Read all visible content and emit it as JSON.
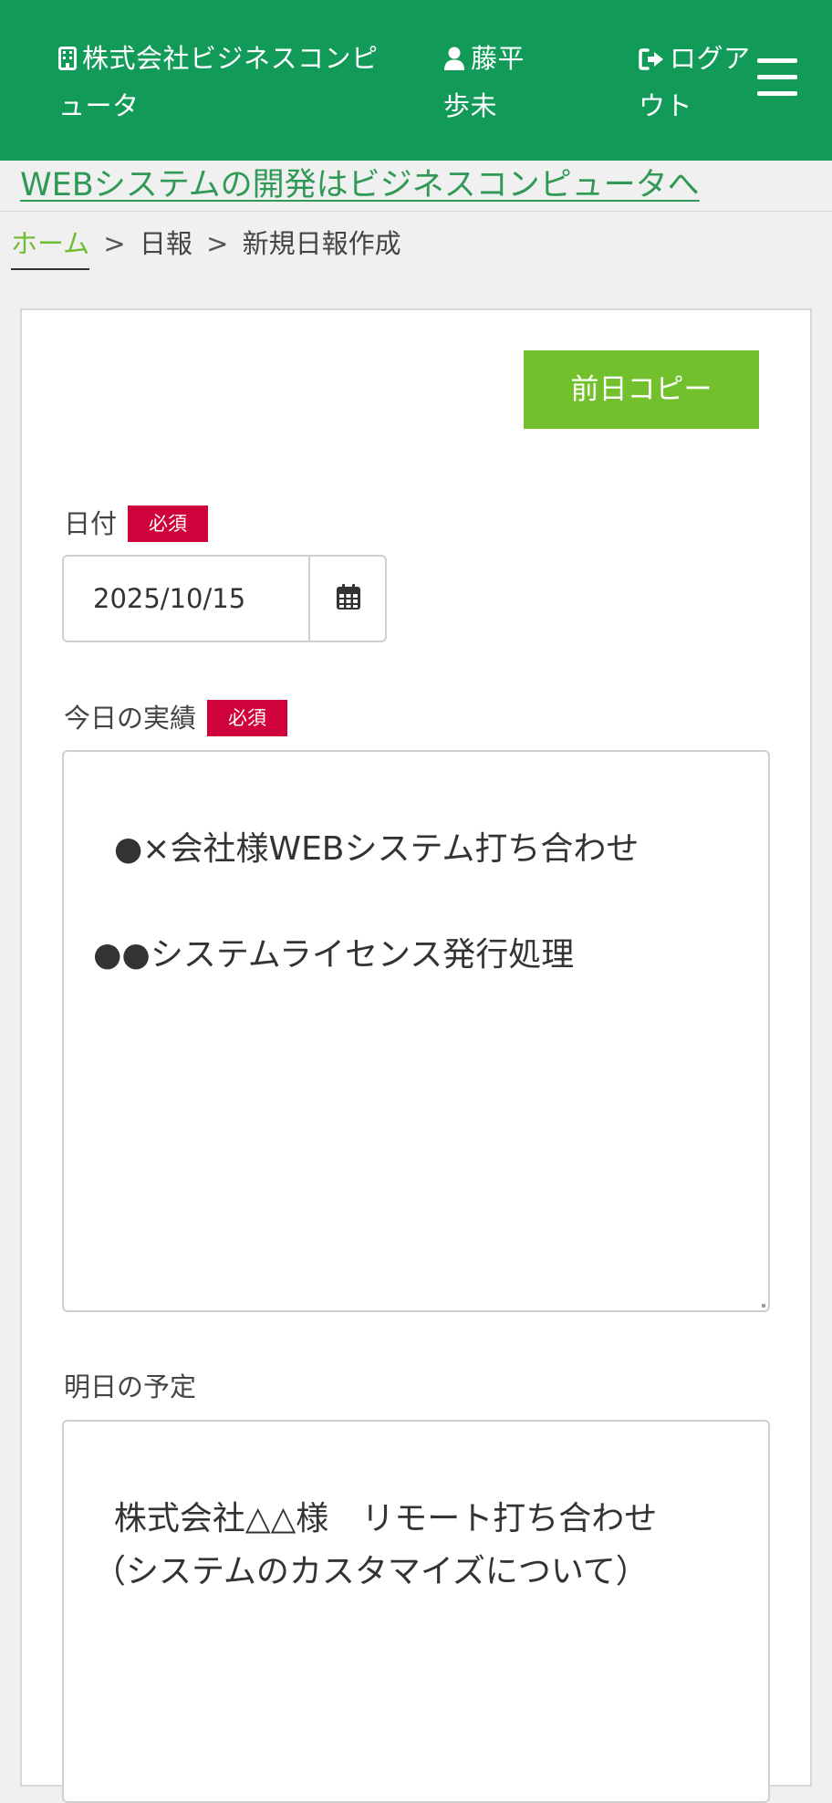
{
  "header": {
    "company": "株式会社ビジネスコンピュータ",
    "user": "藤平歩未",
    "logout": "ログアウト",
    "background_color": "#129b58",
    "icons": {
      "company": "building-icon",
      "user": "user-icon",
      "logout": "sign-out-icon",
      "menu": "hamburger-menu-icon"
    }
  },
  "banner": {
    "link_text": "WEBシステムの開発はビジネスコンピュータへ"
  },
  "breadcrumb": {
    "home": "ホーム",
    "separator": ">",
    "section": "日報",
    "current": "新規日報作成"
  },
  "form": {
    "copy_button": "前日コピー",
    "copy_button_color": "#72c02c",
    "required_badge": "必須",
    "required_badge_color": "#d0023b",
    "date": {
      "label": "日付",
      "value": "2025/10/15",
      "icon": "calendar-icon"
    },
    "achievement": {
      "label": "今日の実績",
      "value": "●×会社様WEBシステム打ち合わせ\n\n●●システムライセンス発行処理"
    },
    "plan": {
      "label": "明日の予定",
      "value": "株式会社△△様　リモート打ち合わせ\n（システムのカスタマイズについて）"
    }
  }
}
